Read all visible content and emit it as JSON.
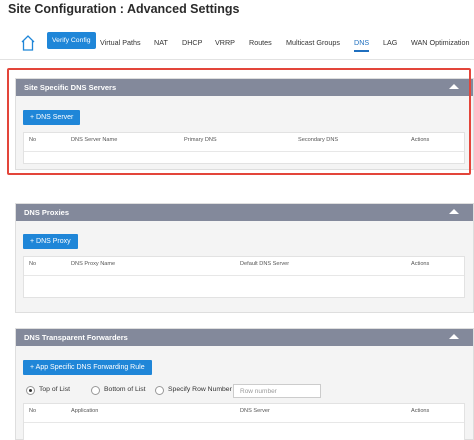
{
  "page": {
    "title": "Site Configuration : Advanced Settings"
  },
  "nav": {
    "home_icon": "home-icon",
    "verify_label": "Verify Config",
    "tabs": [
      "Virtual Paths",
      "NAT",
      "DHCP",
      "VRRP",
      "Routes",
      "Multicast Groups",
      "DNS",
      "LAG",
      "WAN Optimization"
    ],
    "active_tab": "DNS"
  },
  "colors": {
    "accent": "#1f86d8",
    "section_header": "#83899b",
    "highlight": "#e3453a"
  },
  "sections": {
    "dns_servers": {
      "title": "Site Specific DNS Servers",
      "add_label": "+ DNS Server",
      "columns": [
        "No",
        "DNS Server Name",
        "Primary DNS",
        "Secondary DNS",
        "Actions"
      ]
    },
    "dns_proxies": {
      "title": "DNS Proxies",
      "add_label": "+ DNS Proxy",
      "columns": [
        "No",
        "DNS Proxy Name",
        "Default DNS Server",
        "Actions"
      ]
    },
    "transparent_forwarders": {
      "title": "DNS Transparent Forwarders",
      "add_label": "+ App Specific DNS Forwarding Rule",
      "radio_options": [
        "Top of List",
        "Bottom of List",
        "Specify Row Number"
      ],
      "selected_option": "Top of List",
      "row_number_placeholder": "Row number",
      "columns": [
        "No",
        "Application",
        "DNS Server",
        "Actions"
      ]
    }
  }
}
